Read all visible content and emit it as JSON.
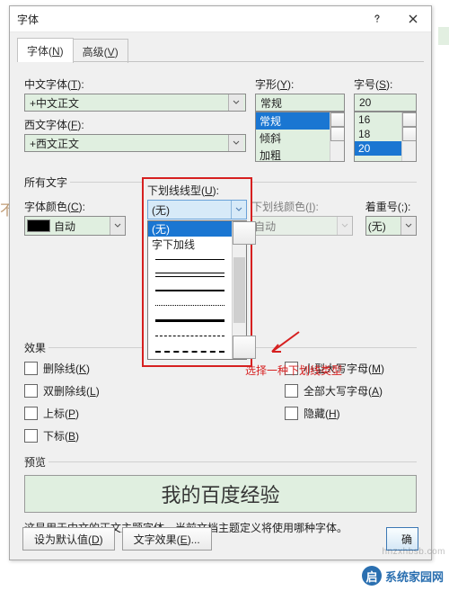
{
  "dialog": {
    "title": "字体",
    "tabs": {
      "font": "字体(N)",
      "advanced": "高级(V)"
    },
    "labels": {
      "cjk_font": "中文字体(T):",
      "latin_font": "西文字体(F):",
      "style": "字形(Y):",
      "size": "字号(S):",
      "all_text": "所有文字",
      "font_color": "字体颜色(C):",
      "underline_style": "下划线线型(U):",
      "underline_color": "下划线颜色(I):",
      "emphasis": "着重号(;):",
      "effects": "效果",
      "preview": "预览"
    },
    "cjk_font": "+中文正文",
    "latin_font": "+西文正文",
    "style_value": "常规",
    "styles": [
      "常规",
      "倾斜",
      "加粗"
    ],
    "style_selected_index": 0,
    "size_value": "20",
    "sizes": [
      "16",
      "18",
      "20"
    ],
    "size_selected_index": 2,
    "font_color_label": "自动",
    "underline_selected": "(无)",
    "underline_options_text": [
      "(无)",
      "字下加线"
    ],
    "underline_color_label": "自动",
    "emphasis_label": "(无)",
    "fx": {
      "strike": "删除线(K)",
      "dstrike": "双删除线(L)",
      "sup": "上标(P)",
      "sub": "下标(B)",
      "smallcaps": "小型大写字母(M)",
      "allcaps": "全部大写字母(A)",
      "hidden": "隐藏(H)"
    },
    "preview_text": "我的百度经验",
    "preview_note": "这是用于中文的正文主题字体。当前文档主题定义将使用哪种字体。",
    "buttons": {
      "default": "设为默认值(D)",
      "texteffects": "文字效果(E)...",
      "ok": "确"
    }
  },
  "annotation": "选择一种下划线类型",
  "watermark": "hnzxhbsb.com",
  "brand": "系统家园网"
}
